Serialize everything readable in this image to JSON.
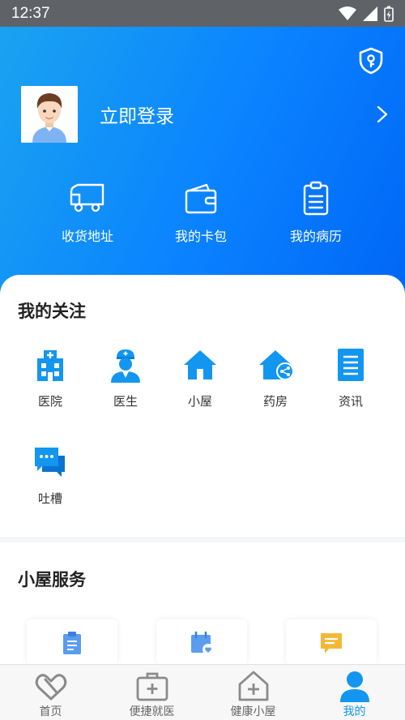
{
  "status_bar": {
    "time": "12:37"
  },
  "profile": {
    "login_label": "立即登录"
  },
  "quick_actions": [
    {
      "label": "收货地址",
      "icon": "truck-icon"
    },
    {
      "label": "我的卡包",
      "icon": "wallet-icon"
    },
    {
      "label": "我的病历",
      "icon": "clipboard-icon"
    }
  ],
  "favorites": {
    "title": "我的关注",
    "items": [
      {
        "label": "医院",
        "icon": "hospital-icon"
      },
      {
        "label": "医生",
        "icon": "doctor-icon"
      },
      {
        "label": "小屋",
        "icon": "house-icon"
      },
      {
        "label": "药房",
        "icon": "pharmacy-icon"
      },
      {
        "label": "资讯",
        "icon": "news-icon"
      },
      {
        "label": "吐槽",
        "icon": "chat-icon"
      }
    ]
  },
  "services": {
    "title": "小屋服务",
    "items": [
      {
        "icon": "clipboard-icon"
      },
      {
        "icon": "calendar-heart-icon"
      },
      {
        "icon": "message-icon"
      }
    ]
  },
  "tabbar": {
    "items": [
      {
        "label": "首页",
        "icon": "heart-logo-icon"
      },
      {
        "label": "便捷就医",
        "icon": "medical-kit-icon"
      },
      {
        "label": "健康小屋",
        "icon": "house-plus-icon"
      },
      {
        "label": "我的",
        "icon": "person-icon"
      }
    ],
    "active_index": 3
  },
  "colors": {
    "primary": "#0a82ff",
    "icon_blue": "#1296f0",
    "tab_active": "#1296f0"
  }
}
